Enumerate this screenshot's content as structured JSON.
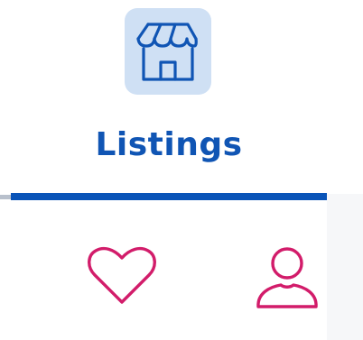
{
  "tabs": {
    "listings": {
      "label": "Listings",
      "icon": "storefront-icon",
      "active": true
    },
    "favorites": {
      "icon": "heart-icon"
    },
    "profile": {
      "icon": "person-icon"
    }
  },
  "colors": {
    "active_blue": "#1055b4",
    "tile_background": "#cfe0f4",
    "inactive_pink": "#d21c6a"
  }
}
